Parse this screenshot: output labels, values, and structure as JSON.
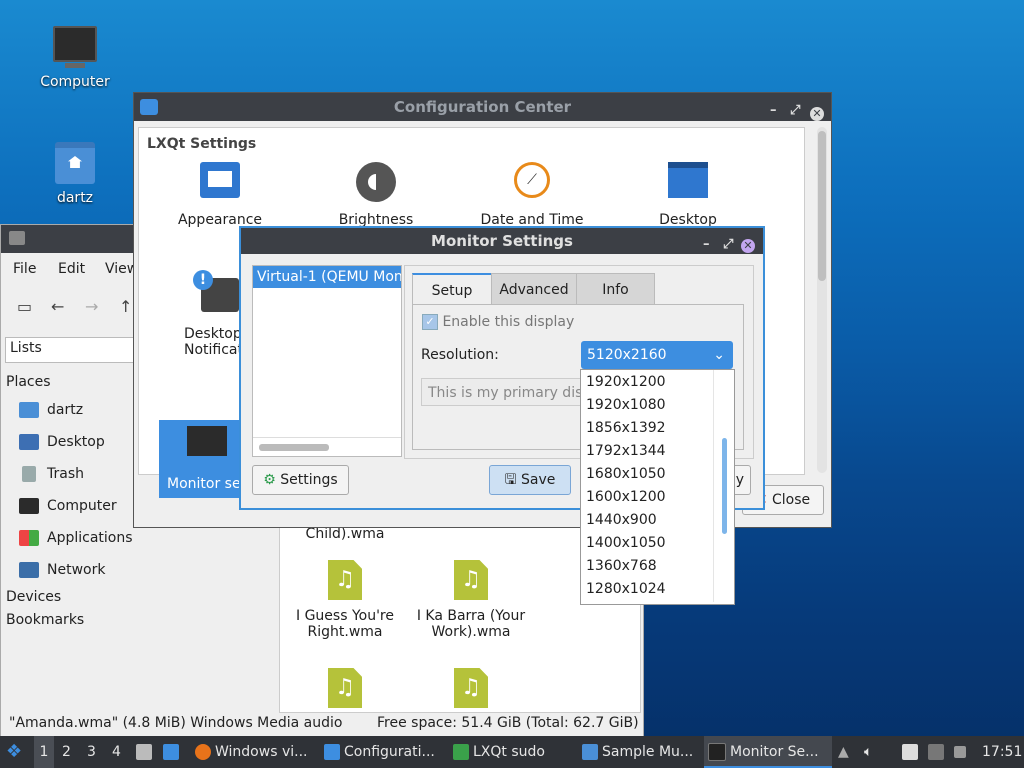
{
  "desktop": {
    "icons": [
      {
        "label": "Computer",
        "icon": "computer-icon"
      },
      {
        "label": "dartz",
        "icon": "home-folder-icon"
      }
    ]
  },
  "file_manager": {
    "menu": [
      "File",
      "Edit",
      "View"
    ],
    "path_mode": "Lists",
    "places_header": "Places",
    "places": [
      "dartz",
      "Desktop",
      "Trash",
      "Computer",
      "Applications",
      "Network"
    ],
    "devices_header": "Devices",
    "bookmarks_header": "Bookmarks",
    "files": [
      {
        "label": "Child).wma"
      },
      {
        "label": "I Guess You're Right.wma"
      },
      {
        "label": "I Ka Barra (Your Work).wma"
      }
    ],
    "status_left": "\"Amanda.wma\" (4.8 MiB) Windows Media audio",
    "status_right": "Free space: 51.4 GiB (Total: 62.7 GiB)"
  },
  "config_center": {
    "title": "Configuration Center",
    "section": "LXQt Settings",
    "items": [
      {
        "label": "Appearance"
      },
      {
        "label": "Brightness"
      },
      {
        "label": "Date and Time"
      },
      {
        "label": "Desktop"
      },
      {
        "label": "Desktop Notificati"
      },
      {
        "label": "Monitor set"
      }
    ],
    "close_label": "Close",
    "apply_fragment": "y"
  },
  "monitor_settings": {
    "title": "Monitor Settings",
    "output": "Virtual-1 (QEMU Mon",
    "tabs": [
      "Setup",
      "Advanced",
      "Info"
    ],
    "enable_label": "Enable this display",
    "resolution_label": "Resolution:",
    "resolution_value": "5120x2160",
    "primary_label": "This is my primary disp",
    "settings_button": "Settings",
    "save_button": "Save",
    "resolution_options": [
      "1920x1200",
      "1920x1080",
      "1856x1392",
      "1792x1344",
      "1680x1050",
      "1600x1200",
      "1440x900",
      "1400x1050",
      "1360x768",
      "1280x1024"
    ]
  },
  "taskbar": {
    "desktops": [
      "1",
      "2",
      "3",
      "4"
    ],
    "tasks": [
      "Windows vi...",
      "Configurati...",
      "LXQt sudo",
      "Sample Mu...",
      "Monitor Se..."
    ],
    "clock": "17:51"
  }
}
